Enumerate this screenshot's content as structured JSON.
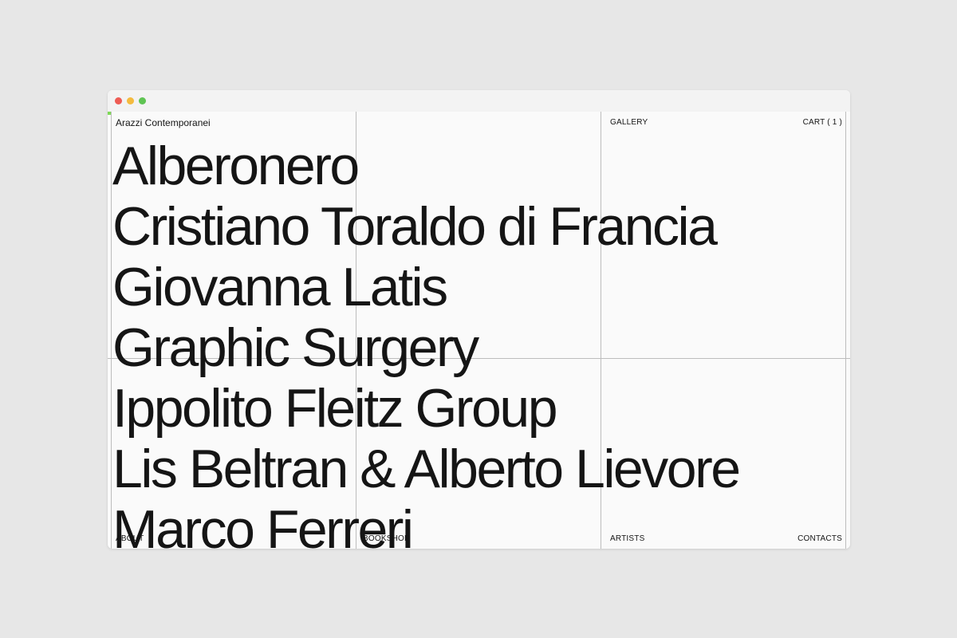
{
  "site": {
    "brand": "Arazzi Contemporanei"
  },
  "nav": {
    "gallery": "GALLERY",
    "cart": "CART ( 1 )",
    "about": "ABOUT",
    "bookshop": "BOOKSHOP",
    "artists": "ARTISTS",
    "contacts": "CONTACTS"
  },
  "artists": [
    "Alberonero",
    "Cristiano Toraldo di Francia",
    "Giovanna Latis",
    "Graphic Surgery",
    "Ippolito Fleitz Group",
    "Lis Beltran & Alberto Lievore",
    "Marco Ferreri"
  ],
  "colors": {
    "background": "#e7e7e7",
    "page": "#fafafa",
    "text": "#151515",
    "grid": "#bdbdbd",
    "accent": "#7ed957"
  }
}
